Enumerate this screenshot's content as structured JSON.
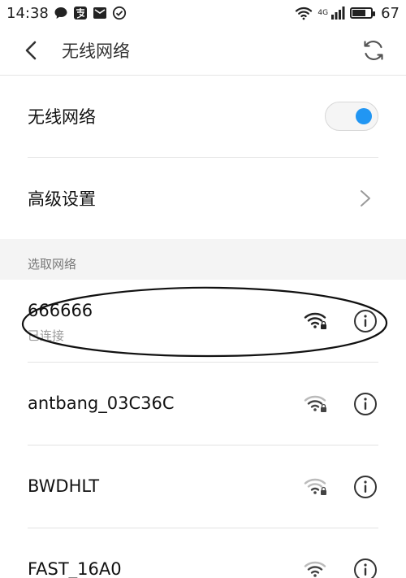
{
  "status_bar": {
    "time": "14:38",
    "left_icons": [
      "chat-bubble-icon",
      "alipay-icon",
      "mail-icon",
      "check-circle-icon"
    ],
    "network_type": "4G",
    "battery_level": "67"
  },
  "header": {
    "title": "无线网络",
    "back_icon": "chevron-left-icon",
    "refresh_icon": "refresh-icon"
  },
  "settings": {
    "wifi_toggle_label": "无线网络",
    "wifi_enabled": true,
    "advanced_label": "高级设置"
  },
  "section": {
    "label": "选取网络"
  },
  "networks": [
    {
      "name": "666666",
      "status": "已连接",
      "secured": true,
      "connected": true
    },
    {
      "name": "antbang_03C36C",
      "status": "",
      "secured": true,
      "connected": false
    },
    {
      "name": "BWDHLT",
      "status": "",
      "secured": true,
      "connected": false
    },
    {
      "name": "FAST_16A0",
      "status": "",
      "secured": true,
      "connected": false
    }
  ],
  "colors": {
    "accent": "#2196f3",
    "section_bg": "#f4f4f4"
  }
}
